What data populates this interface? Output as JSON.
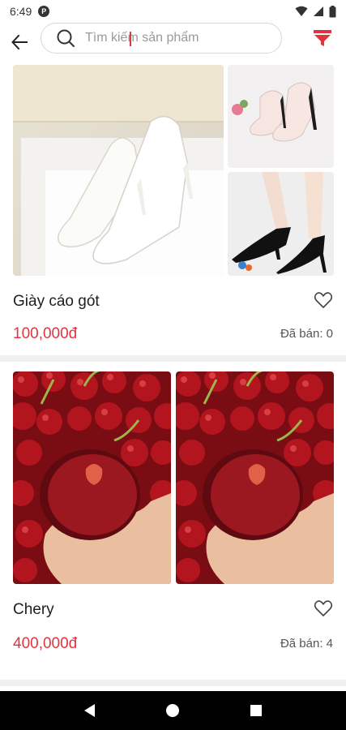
{
  "status_bar": {
    "time": "6:49",
    "app_icon_letter": "P"
  },
  "search": {
    "placeholder": "Tìm kiếm sản phẩm"
  },
  "colors": {
    "accent": "#e0353f",
    "filter": "#e0353f"
  },
  "products": [
    {
      "name": "Giày cáo gót",
      "price": "100,000đ",
      "sold": "Đã bán: 0"
    },
    {
      "name": "Chery",
      "price": "400,000đ",
      "sold": "Đã bán: 4"
    }
  ],
  "icons": {
    "back": "arrow-left-icon",
    "search": "search-icon",
    "filter": "filter-icon",
    "favorite": "heart-outline-icon",
    "nav_back": "triangle-back-icon",
    "nav_home": "circle-home-icon",
    "nav_recent": "square-recent-icon"
  }
}
